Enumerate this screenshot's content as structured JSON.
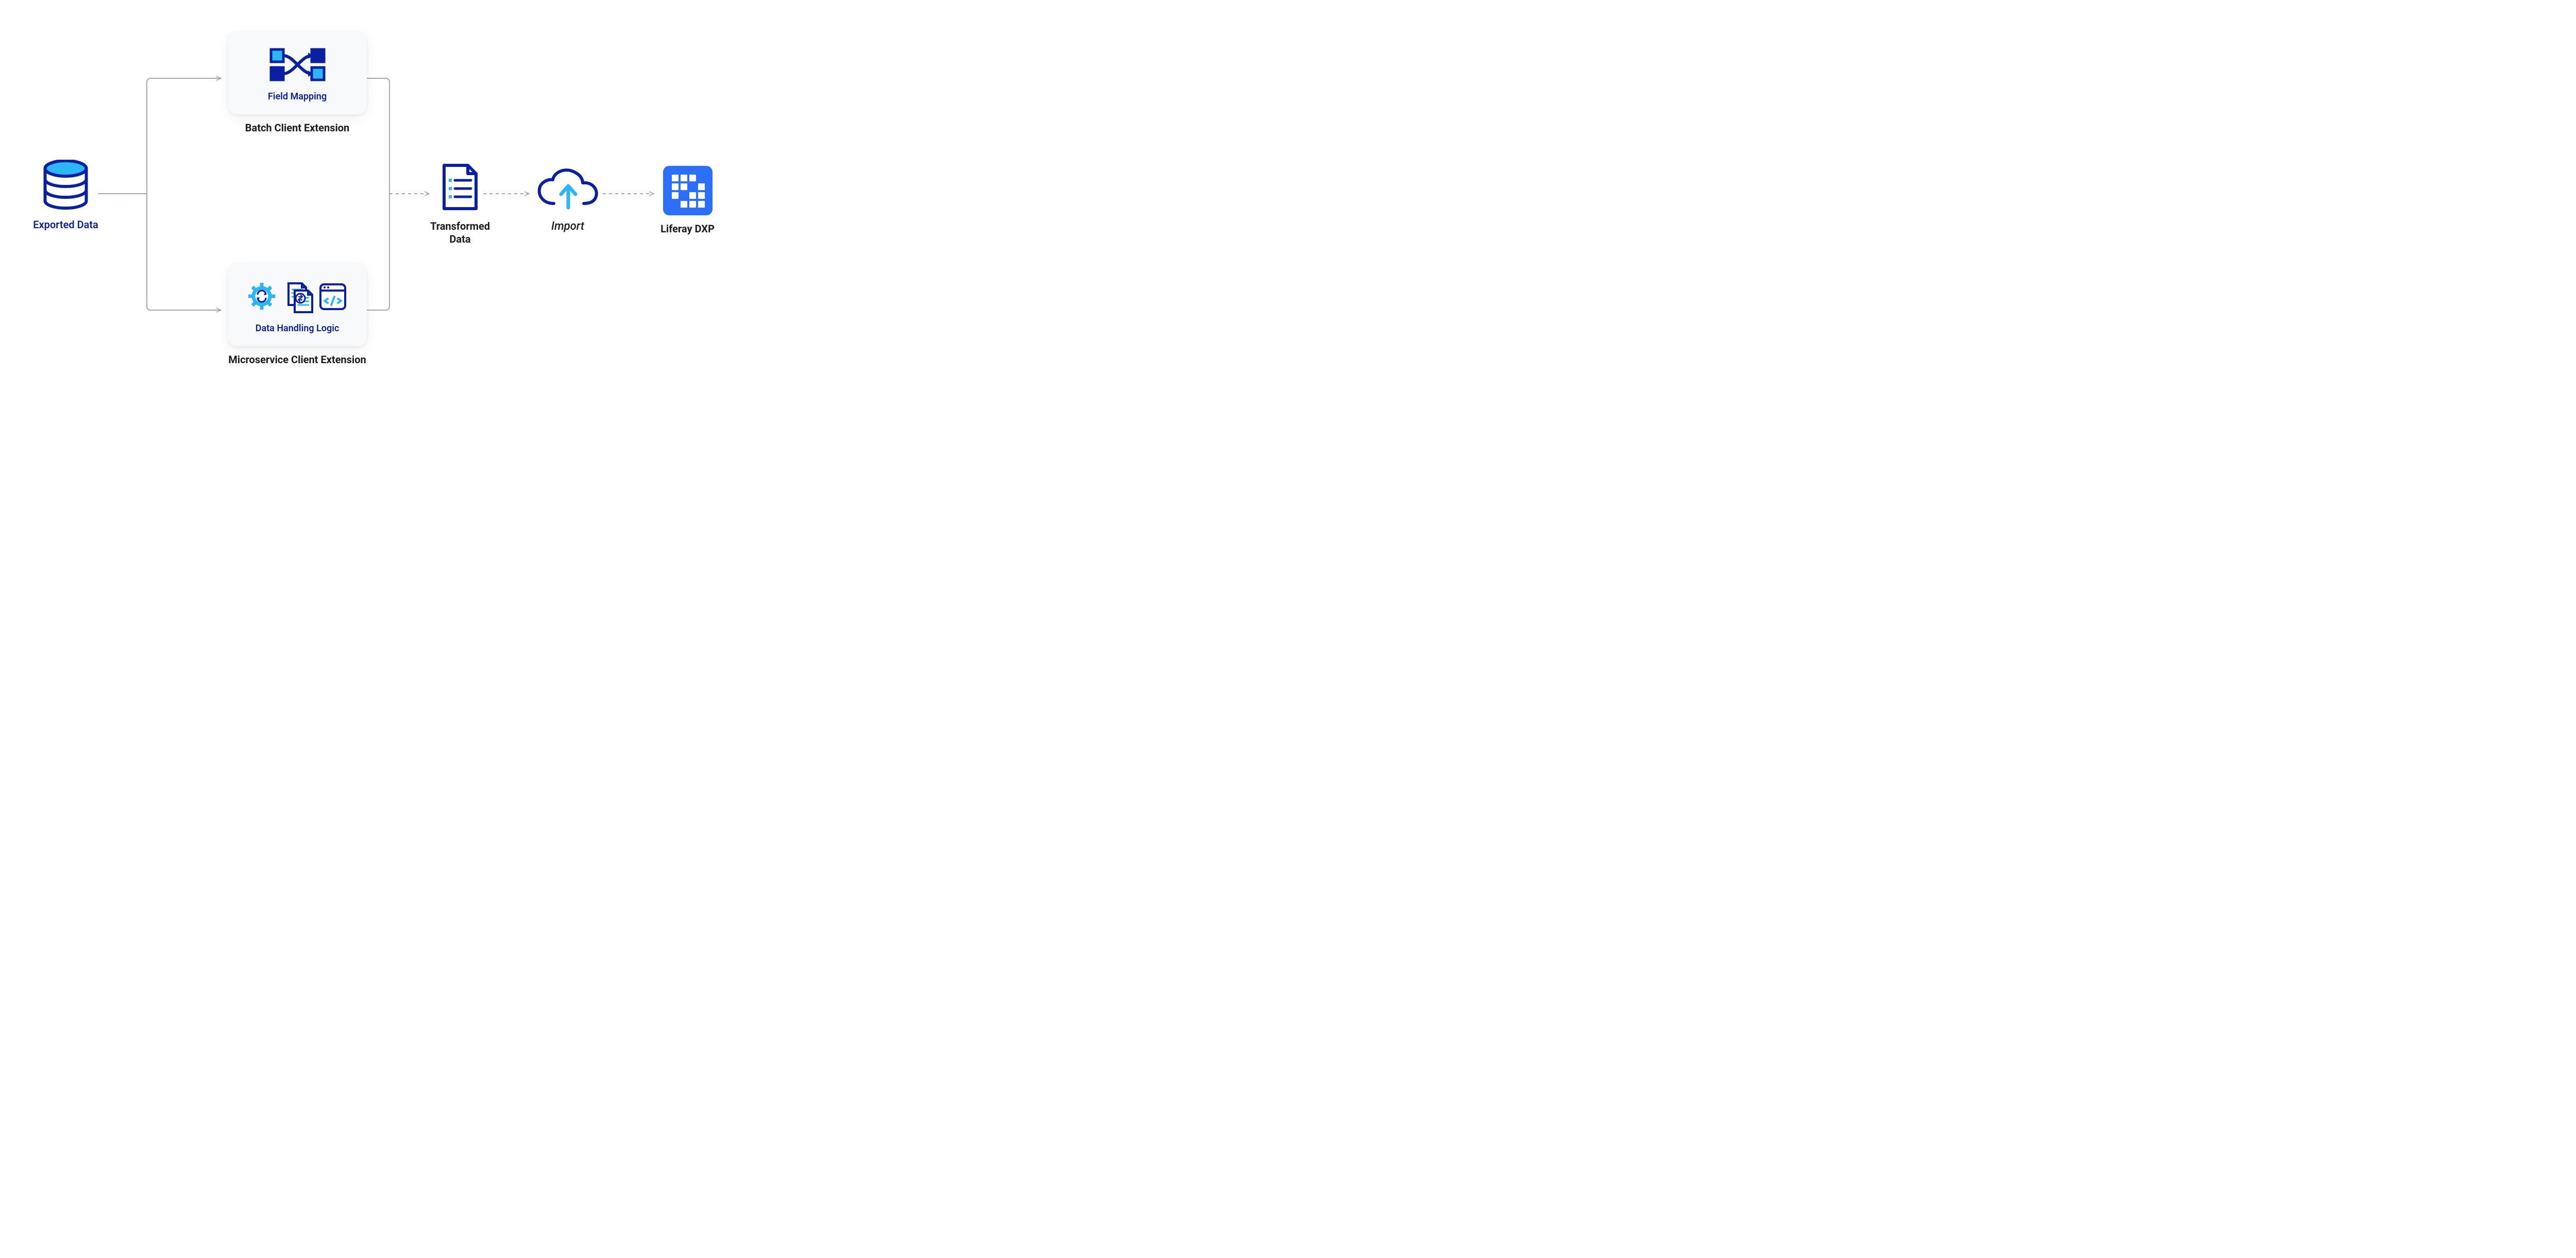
{
  "exported_data": {
    "label": "Exported Data"
  },
  "batch_extension": {
    "title": "Batch Client Extension",
    "card_label": "Field Mapping"
  },
  "micro_extension": {
    "title": "Microservice Client Extension",
    "card_label": "Data Handling Logic"
  },
  "transformed": {
    "label": "Transformed Data"
  },
  "import_step": {
    "label": "Import"
  },
  "liferay": {
    "label": "Liferay DXP"
  },
  "colors": {
    "navy": "#0B1FA3",
    "sky": "#2DB6F5",
    "text": "#1a1a1a",
    "connector_solid": "#b0b4bb",
    "connector_dash": "#b0b4bb",
    "card_bg": "#f8f9fb",
    "blue_fill": "#2D6FF7"
  }
}
